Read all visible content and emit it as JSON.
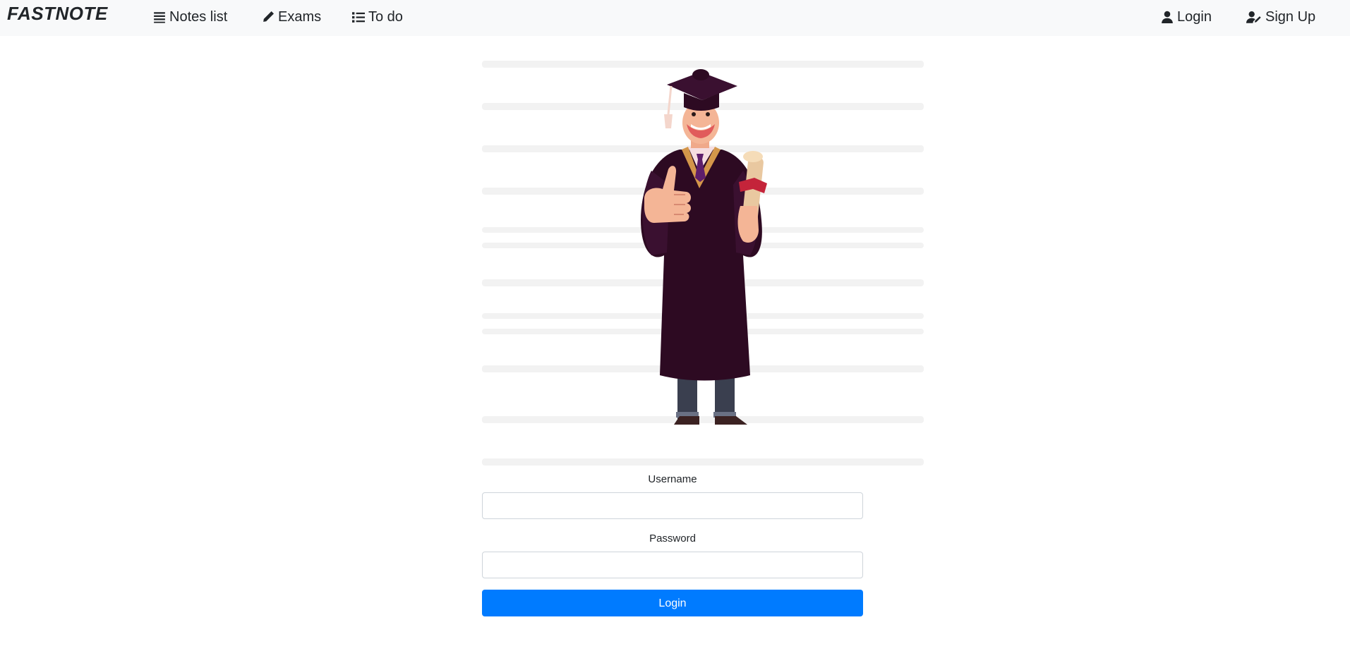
{
  "brand": "FASTNOTE",
  "nav": {
    "left": [
      {
        "label": "Notes list",
        "icon": "list-lines-icon"
      },
      {
        "label": "Exams",
        "icon": "pencil-icon"
      },
      {
        "label": "To do",
        "icon": "bullet-list-icon"
      }
    ],
    "right": [
      {
        "label": "Login",
        "icon": "user-icon"
      },
      {
        "label": "Sign Up",
        "icon": "user-edit-icon"
      }
    ]
  },
  "hero": {
    "icon": "graduate-illustration"
  },
  "form": {
    "username_label": "Username",
    "username_value": "",
    "password_label": "Password",
    "password_value": "",
    "submit_label": "Login"
  },
  "colors": {
    "primary": "#007bff",
    "navbar_bg": "#f8f9fa",
    "gown": "#2d0a22",
    "gown_trim": "#d4964a",
    "tie": "#5e1e6b"
  }
}
